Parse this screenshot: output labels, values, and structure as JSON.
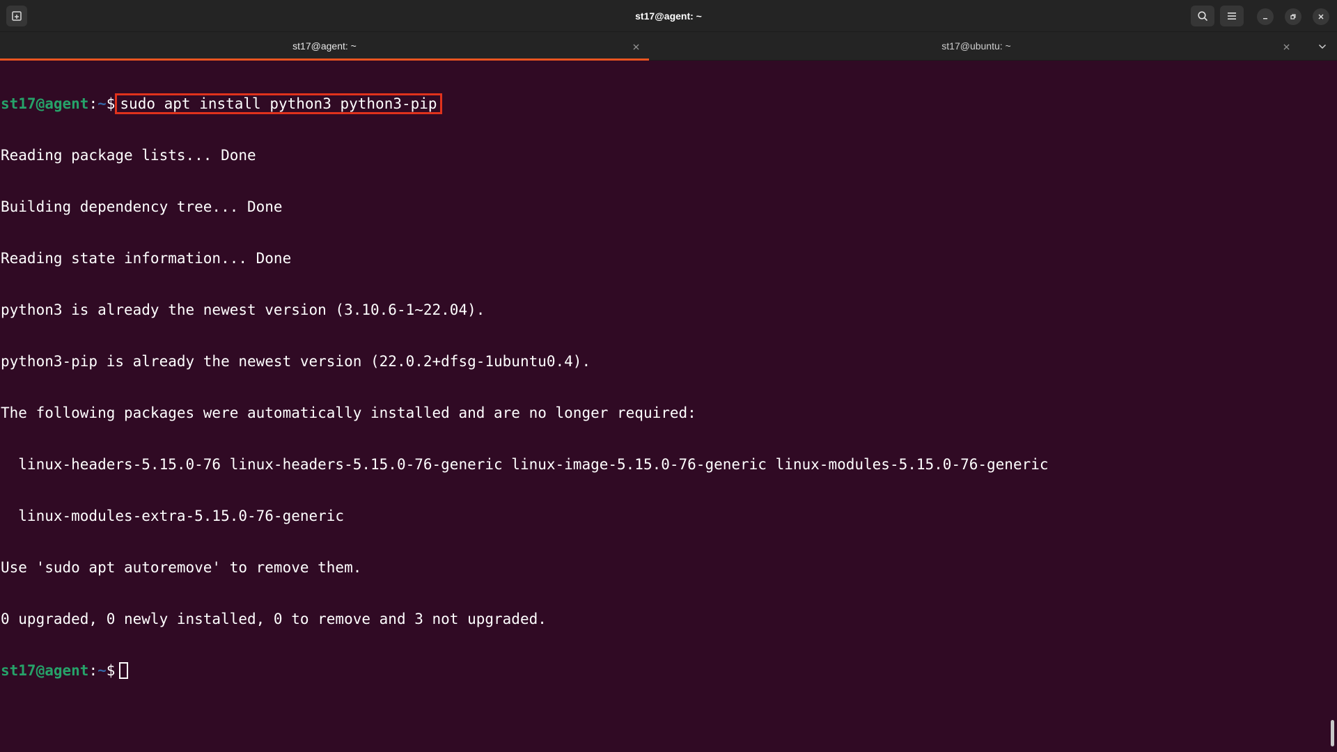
{
  "window": {
    "title": "st17@agent: ~"
  },
  "icons": {
    "new_tab": "new-tab-icon",
    "search": "search-icon",
    "menu": "hamburger-menu-icon",
    "minimize": "minimize-icon",
    "maximize": "restore-icon",
    "close": "close-icon",
    "tab_close": "close-icon",
    "tab_dropdown": "chevron-down-icon"
  },
  "tabs": [
    {
      "label": "st17@agent: ~",
      "active": true
    },
    {
      "label": "st17@ubuntu: ~",
      "active": false
    }
  ],
  "colors": {
    "terminal_bg": "#300a24",
    "prompt_user": "#26a269",
    "prompt_path": "#3465a4",
    "highlight_box": "#e0321c",
    "tab_indicator": "#e95420"
  },
  "terminal": {
    "prompt": {
      "user_host": "st17@agent",
      "separator": ":",
      "path": "~",
      "symbol": "$"
    },
    "command": "sudo apt install python3 python3-pip",
    "output": [
      "Reading package lists... Done",
      "Building dependency tree... Done",
      "Reading state information... Done",
      "python3 is already the newest version (3.10.6-1~22.04).",
      "python3-pip is already the newest version (22.0.2+dfsg-1ubuntu0.4).",
      "The following packages were automatically installed and are no longer required:",
      "  linux-headers-5.15.0-76 linux-headers-5.15.0-76-generic linux-image-5.15.0-76-generic linux-modules-5.15.0-76-generic",
      "  linux-modules-extra-5.15.0-76-generic",
      "Use 'sudo apt autoremove' to remove them.",
      "0 upgraded, 0 newly installed, 0 to remove and 3 not upgraded."
    ]
  }
}
